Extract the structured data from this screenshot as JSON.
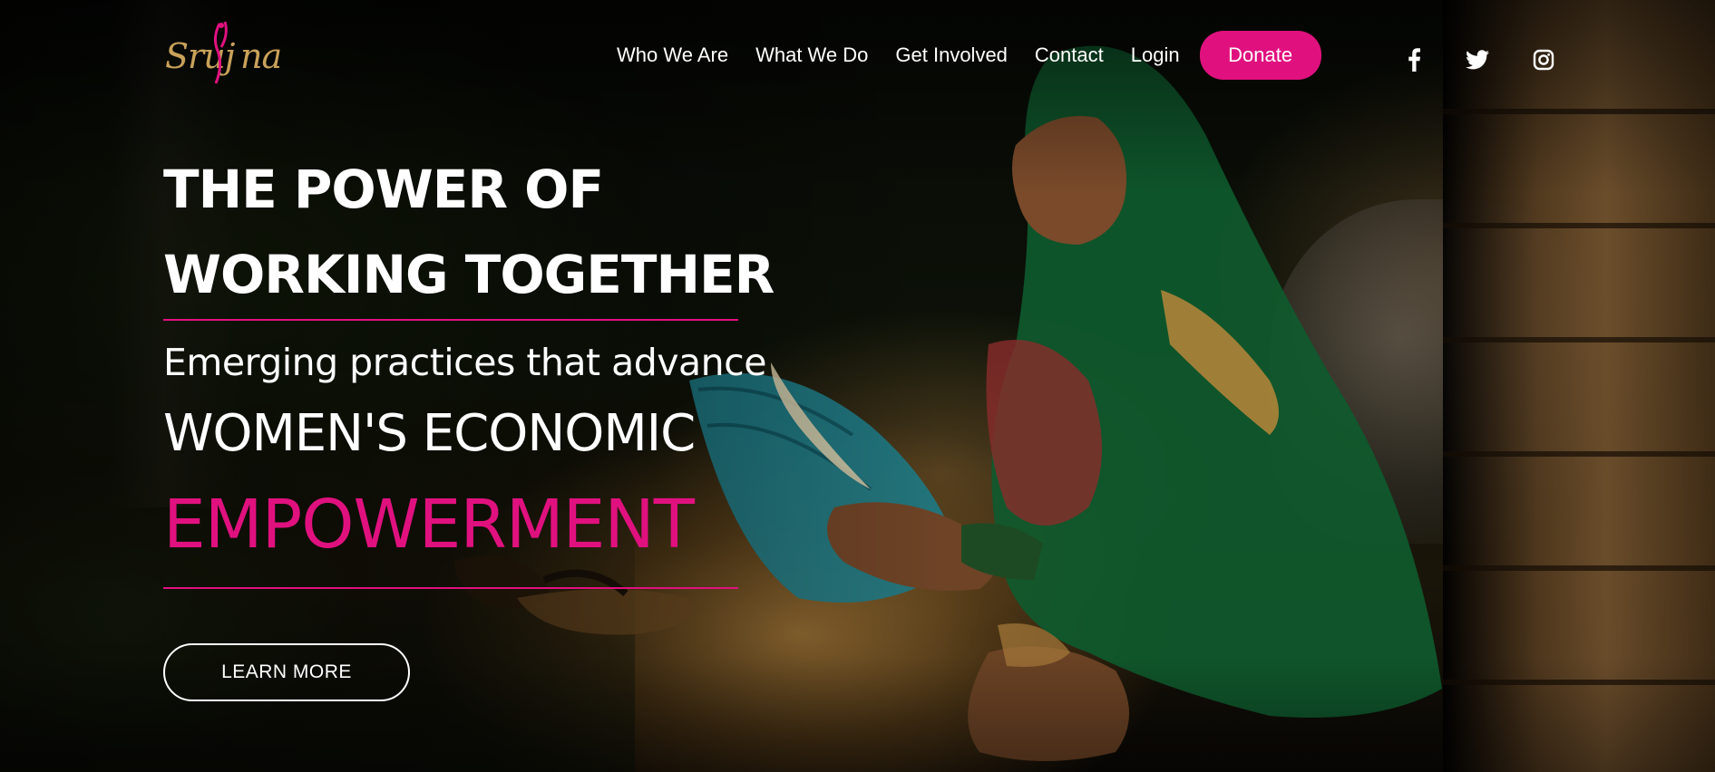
{
  "brand": {
    "logo_text": "Sruj na",
    "accent_color": "#e0117f",
    "logo_color": "#c9a25a"
  },
  "nav": {
    "items": [
      {
        "label": "Who We Are"
      },
      {
        "label": "What We Do"
      },
      {
        "label": "Get Involved"
      },
      {
        "label": "Contact"
      },
      {
        "label": "Login"
      }
    ],
    "donate_label": "Donate"
  },
  "social": [
    {
      "icon": "facebook-icon"
    },
    {
      "icon": "twitter-icon"
    },
    {
      "icon": "instagram-icon"
    }
  ],
  "hero": {
    "title_line1": "THE POWER OF",
    "title_line2": "WORKING TOGETHER",
    "subtitle": "Emerging practices that advance",
    "line_economic": "WOMEN'S ECONOMIC",
    "line_empowerment": "EMPOWERMENT",
    "cta_label": "LEARN MORE"
  }
}
